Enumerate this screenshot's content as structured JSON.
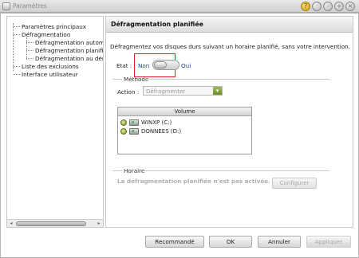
{
  "window": {
    "title": "Paramètres",
    "buttons": [
      "help",
      "minimize-alt",
      "minimize",
      "maximize",
      "close"
    ]
  },
  "tree": {
    "items": [
      {
        "label": "Paramètres principaux"
      },
      {
        "label": "Défragmentation"
      },
      {
        "label": "Défragmentation automa"
      },
      {
        "label": "Défragmentation planifiée"
      },
      {
        "label": "Défragmentation au dém"
      },
      {
        "label": "Liste des exclusions"
      },
      {
        "label": "Interface utilisateur"
      }
    ],
    "selected_index": 3
  },
  "panel": {
    "title": "Défragmentation planifiée",
    "description": "Défragmentez vos disques durs suivant un horaire planifié, sans votre intervention.",
    "state": {
      "label": "Etat :",
      "off_label": "Non",
      "on_label": "Oui",
      "value": "Non"
    },
    "methode": {
      "section_label": "Méthode",
      "action_label": "Action :",
      "action_value": "Défragmenter"
    },
    "volumes": {
      "header": "Volume",
      "items": [
        {
          "name": "WINXP (C:)"
        },
        {
          "name": "DONNEES (D:)"
        }
      ]
    },
    "horaire": {
      "section_label": "Horaire",
      "message": "La défragmentation planifiée n'est pas activée.",
      "configure_label": "Configurer"
    }
  },
  "footer": {
    "recommande": "Recommandé",
    "ok": "OK",
    "annuler": "Annuler",
    "appliquer": "Appliquer"
  },
  "colors": {
    "accent_link": "#1a3fb5",
    "highlight_border": "#e0202a",
    "help_button": "#d7a81e",
    "combo_button": "#7fa03a"
  }
}
